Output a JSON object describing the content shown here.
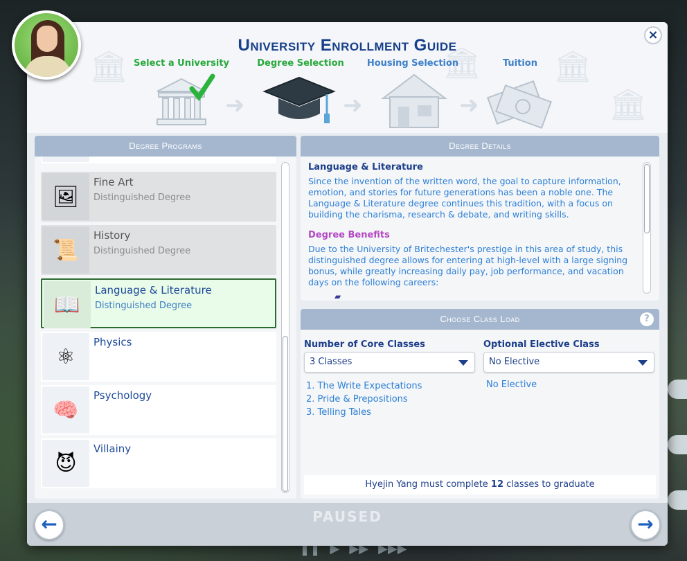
{
  "dialog": {
    "title": "University Enrollment Guide",
    "close_label": "×"
  },
  "steps": [
    {
      "label": "Select a University",
      "state": "done"
    },
    {
      "label": "Degree Selection",
      "state": "active"
    },
    {
      "label": "Housing Selection",
      "state": "todo"
    },
    {
      "label": "Tuition",
      "state": "todo"
    }
  ],
  "programs": {
    "header": "Degree Programs",
    "items": [
      {
        "name": "Fine Art",
        "sub": "Distinguished Degree",
        "icon": "painting-icon"
      },
      {
        "name": "History",
        "sub": "Distinguished Degree",
        "icon": "scroll-icon"
      },
      {
        "name": "Language & Literature",
        "sub": "Distinguished Degree",
        "icon": "book-icon"
      },
      {
        "name": "Physics",
        "sub": "",
        "icon": "atom-icon"
      },
      {
        "name": "Psychology",
        "sub": "",
        "icon": "brain-icon"
      },
      {
        "name": "Villainy",
        "sub": "",
        "icon": "devil-icon"
      }
    ]
  },
  "details": {
    "header": "Degree Details",
    "title": "Language & Literature",
    "description": "Since the invention of the written word, the goal to capture information, emotion, and stories for future generations has been a noble one. The Language & Literature degree continues this tradition, with a focus on building the charisma, research & debate, and writing skills.",
    "benefits_title": "Degree Benefits",
    "benefits_text": "Due to the University of Britechester's prestige in this area of study, this distinguished degree allows for entering at high-level with a large signing bonus, while greatly increasing daily pay, job performance, and vacation days on the following careers:"
  },
  "classload": {
    "header": "Choose Class Load",
    "help_label": "?",
    "core_label": "Number of Core Classes",
    "core_value": "3 Classes",
    "elective_label": "Optional Elective Class",
    "elective_value": "No Elective",
    "classes": [
      "1.  The Write Expectations",
      "2.  Pride & Prepositions",
      "3.  Telling Tales"
    ],
    "elective_selected": "No Elective",
    "grad_prefix": "Hyejin Yang must complete ",
    "grad_count": "12",
    "grad_suffix": " classes to graduate"
  },
  "bottom": {
    "back_label": "←",
    "next_label": "→",
    "paused": "PAUSED"
  },
  "colors": {
    "accent": "#173f8a",
    "link_blue": "#2d7fd6",
    "done_green": "#27a83a",
    "header_blue": "#a5b7cf"
  }
}
